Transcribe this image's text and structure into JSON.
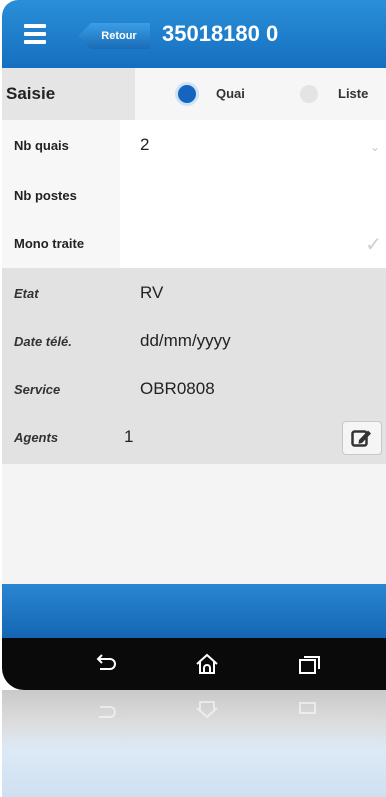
{
  "header": {
    "menu_icon": "hamburger-menu-icon",
    "back_label": "Retour",
    "title": "35018180 0"
  },
  "mode": {
    "label": "Saisie",
    "options": [
      {
        "label": "Quai",
        "selected": true
      },
      {
        "label": "Liste",
        "selected": false
      }
    ]
  },
  "form": {
    "nb_quais": {
      "label": "Nb quais",
      "value": "2"
    },
    "nb_postes": {
      "label": "Nb postes",
      "value": ""
    },
    "mono_traite": {
      "label": "Mono traite",
      "checked": true
    }
  },
  "details": {
    "etat": {
      "label": "Etat",
      "value": "RV"
    },
    "date_tele": {
      "label": "Date télé.",
      "placeholder": "dd/mm/yyyy"
    },
    "service": {
      "label": "Service",
      "value": "OBR0808"
    },
    "agents": {
      "label": "Agents",
      "value": "1"
    }
  },
  "colors": {
    "accent": "#1a78c8",
    "section_gray": "#e2e2e2",
    "navbar": "#0a0a0a"
  },
  "navbar": {
    "icons": [
      "back-icon",
      "home-icon",
      "recent-apps-icon"
    ]
  }
}
